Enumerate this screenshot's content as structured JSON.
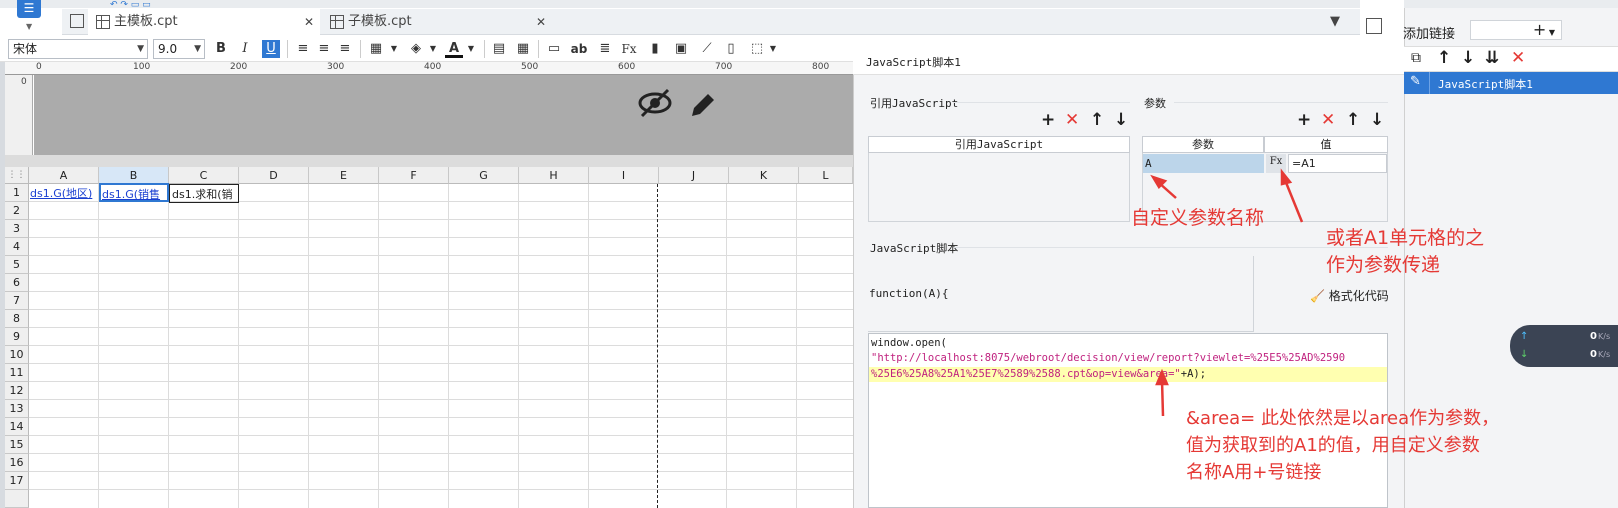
{
  "tabs": [
    {
      "label": "主模板.cpt"
    },
    {
      "label": "子模板.cpt"
    }
  ],
  "toolbar": {
    "font": "宋体",
    "font_size": "9.0"
  },
  "ruler": {
    "marks": [
      "0",
      "100",
      "200",
      "300",
      "400",
      "500",
      "600",
      "700",
      "800"
    ]
  },
  "columns": [
    "A",
    "B",
    "C",
    "D",
    "E",
    "F",
    "G",
    "H",
    "I",
    "J",
    "K",
    "L"
  ],
  "rows": [
    "1",
    "2",
    "3",
    "4",
    "5",
    "6",
    "7",
    "8",
    "9",
    "10",
    "11",
    "12",
    "13",
    "14",
    "15",
    "16",
    "17"
  ],
  "cells": {
    "a1": "ds1.G(地区)",
    "b1": "ds1.G(销售",
    "c1": "ds1.求和(销"
  },
  "panel": {
    "title": "JavaScript脚本1",
    "ref_section": "引用JavaScript",
    "ref_header": "引用JavaScript",
    "param_section": "参数",
    "param_col": "参数",
    "value_col": "值",
    "param_name": "A",
    "param_value": "=A1",
    "script_section": "JavaScript脚本",
    "function_sig": "function(A){",
    "format_btn": "格式化代码",
    "code_line1": "window.open(",
    "code_line2": "\"http://localhost:8075/webroot/decision/view/report?viewlet=%25E5%25AD%2590",
    "code_line3a": "%25E6%25A8%25A1%25E7%2589%2588.cpt&op=view&area=\"",
    "code_line3b": "+A);"
  },
  "far": {
    "add_link": "添加链接",
    "item": "JavaScript脚本1",
    "net_up": "0",
    "net_down": "0",
    "unit": "K/s"
  },
  "annotations": {
    "a1": "自定义参数名称",
    "a2_l1": "或者A1单元格的之",
    "a2_l2": "作为参数传递",
    "a3_l1": "&area= 此处依然是以area作为参数，",
    "a3_l2": "值为获取到的A1的值，用自定义参数",
    "a3_l3": "名称A用+号链接"
  },
  "colors": {
    "accent": "#2f78d2",
    "annotation": "#e53935",
    "code_string": "#c0227f"
  }
}
